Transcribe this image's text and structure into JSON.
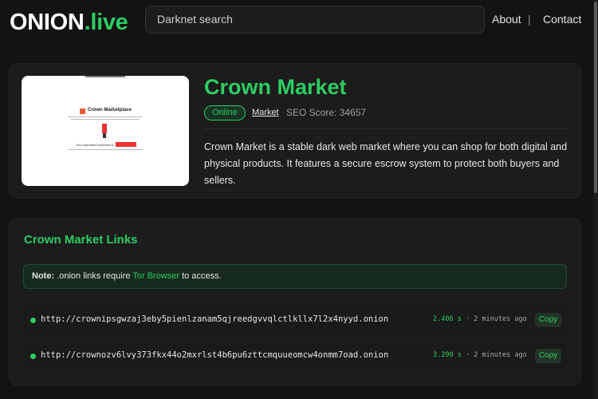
{
  "brand": {
    "name_main": "ONION",
    "name_tld": ".live"
  },
  "search": {
    "placeholder": "Darknet search"
  },
  "nav": {
    "about": "About",
    "separator": "|",
    "contact": "Contact"
  },
  "site": {
    "title": "Crown Market",
    "status": "Online",
    "category": "Market",
    "seo_score": "SEO Score: 34657",
    "description": "Crown Market is a stable dark web market where you can shop for both digital and physical products. It features a secure escrow system to protect both buyers and sellers.",
    "screenshot": {
      "title": "Crown Marketplace",
      "badge_text": "Your estimated wait time is"
    }
  },
  "links": {
    "heading": "Crown Market Links",
    "note_label": "Note:",
    "note_pre": " .onion links require ",
    "note_link": "Tor Browser",
    "note_post": " to access.",
    "items": [
      {
        "url": "http://crownipsgwzaj3eby5pienlzanam5qjreedgvvqlctlkllx7l2x4nyyd.onion",
        "time": "2.406 s",
        "ago": " · 2 minutes ago",
        "copy": "Copy"
      },
      {
        "url": "http://crownozv6lvy373fkx44o2mxrlst4b6pu6zttcmquueomcw4onmm7oad.onion",
        "time": "3.290 s",
        "ago": " · 2 minutes ago",
        "copy": "Copy"
      }
    ]
  },
  "colors": {
    "accent": "#2ecc63",
    "background": "#131313",
    "card": "#1c1c1c"
  }
}
